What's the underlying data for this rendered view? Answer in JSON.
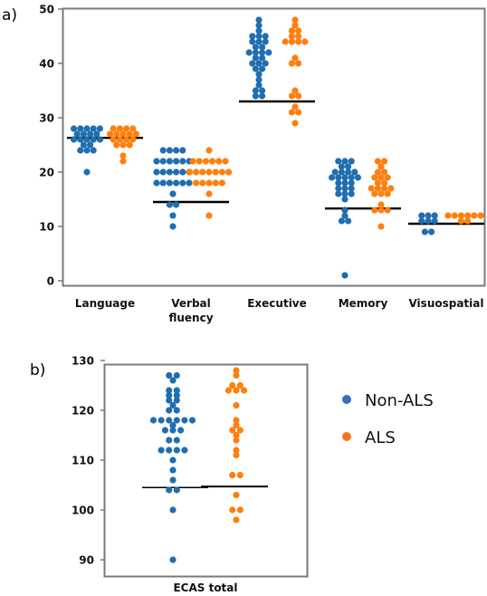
{
  "chart_data": [
    {
      "type": "scatter",
      "subtype": "beeswarm",
      "panel_label": "a)",
      "title": "",
      "xlabel": "",
      "ylabel": "",
      "ylim": [
        -1,
        50
      ],
      "yticks": [
        0,
        10,
        20,
        30,
        40,
        50
      ],
      "grid": false,
      "categories": [
        "Language",
        "Verbal fluency",
        "Executive",
        "Memory",
        "Visuospatial"
      ],
      "category_label_lines": [
        [
          "Language"
        ],
        [
          "Verbal",
          "fluency"
        ],
        [
          "Executive"
        ],
        [
          "Memory"
        ],
        [
          "Visuospatial"
        ]
      ],
      "series": [
        {
          "name": "Non-ALS",
          "color": "#1f6eb0",
          "values": [
            [
              28,
              28,
              28,
              28,
              28,
              27,
              27,
              27,
              27,
              26,
              26,
              26,
              26,
              26,
              25,
              25,
              24,
              24,
              24,
              20
            ],
            [
              24,
              24,
              24,
              24,
              22,
              22,
              22,
              22,
              22,
              22,
              20,
              20,
              20,
              20,
              20,
              20,
              18,
              18,
              18,
              18,
              18,
              18,
              16,
              14,
              14,
              12,
              10
            ],
            [
              48,
              47,
              46,
              45,
              45,
              45,
              44,
              44,
              44,
              43,
              43,
              42,
              42,
              42,
              42,
              41,
              41,
              40,
              40,
              40,
              39,
              39,
              38,
              37,
              36,
              35,
              35,
              34,
              34
            ],
            [
              22,
              22,
              22,
              21,
              21,
              20,
              20,
              20,
              20,
              19,
              19,
              19,
              19,
              19,
              18,
              18,
              18,
              17,
              17,
              17,
              16,
              16,
              16,
              15,
              13,
              12,
              11,
              11,
              1
            ],
            [
              12,
              12,
              12,
              11,
              11,
              11,
              9,
              9
            ]
          ]
        },
        {
          "name": "ALS",
          "color": "#ff7f0e",
          "values": [
            [
              28,
              28,
              28,
              28,
              27,
              27,
              27,
              27,
              27,
              26,
              26,
              26,
              26,
              25,
              25,
              25,
              23,
              22
            ],
            [
              24,
              22,
              22,
              22,
              22,
              22,
              22,
              20,
              20,
              20,
              20,
              20,
              20,
              20,
              18,
              18,
              18,
              18,
              18,
              16,
              12
            ],
            [
              48,
              47,
              46,
              46,
              45,
              45,
              44,
              44,
              44,
              44,
              41,
              40,
              40,
              35,
              34,
              34,
              32,
              31,
              31,
              29
            ],
            [
              22,
              22,
              21,
              20,
              20,
              19,
              19,
              19,
              18,
              18,
              17,
              17,
              17,
              17,
              16,
              16,
              16,
              14,
              13,
              13,
              13,
              10
            ],
            [
              12,
              12,
              12,
              11,
              11,
              12,
              12,
              12
            ]
          ]
        }
      ],
      "medians": [
        26.3,
        14.5,
        33.0,
        13.3,
        10.5
      ]
    },
    {
      "type": "scatter",
      "subtype": "beeswarm",
      "panel_label": "b)",
      "title": "",
      "xlabel": "",
      "ylabel": "",
      "ylim": [
        86,
        130.5
      ],
      "yticks": [
        90,
        100,
        110,
        120,
        130
      ],
      "grid": false,
      "categories": [
        "ECAS total"
      ],
      "series": [
        {
          "name": "Non-ALS",
          "color": "#1f6eb0",
          "values": [
            [
              127,
              127,
              126,
              124,
              124,
              123,
              123,
              122,
              122,
              121,
              120,
              120,
              118,
              118,
              118,
              118,
              118,
              118,
              117,
              116,
              116,
              116,
              114,
              114,
              112,
              112,
              112,
              112,
              110,
              108,
              106,
              104,
              104,
              100,
              90
            ]
          ]
        },
        {
          "name": "ALS",
          "color": "#ff7f0e",
          "values": [
            [
              128,
              127,
              125,
              125,
              124,
              124,
              124,
              121,
              118,
              117,
              116,
              116,
              115,
              114,
              112,
              111,
              107,
              107,
              103,
              100,
              100,
              98
            ]
          ]
        }
      ],
      "medians": [
        104.5,
        104.7
      ]
    }
  ],
  "legend": {
    "placement": "right",
    "items": [
      {
        "label": "Non-ALS",
        "color": "#3a6fb7"
      },
      {
        "label": "ALS",
        "color": "#f7741f"
      }
    ]
  }
}
